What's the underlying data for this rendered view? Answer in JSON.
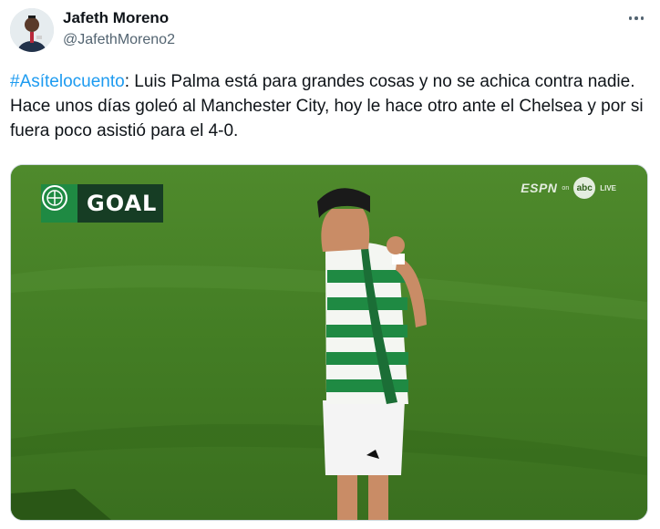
{
  "author": {
    "name": "Jafeth Moreno",
    "handle": "@JafethMoreno2"
  },
  "icons": {
    "avatar": "avatar-photo",
    "more": "more-options-icon",
    "club_crest": "celtic-crest-icon"
  },
  "tweet": {
    "hashtag": "#Asítelocuento",
    "body": ": Luis Palma está para grandes cosas y no se achica contra nadie. Hace unos días goleó al Manchester City, hoy le hace otro ante el Chelsea y por si fuera poco asistió para el 4-0."
  },
  "media": {
    "overlay_label": "GOAL",
    "broadcaster": "ESPN",
    "broadcaster_on": "on",
    "network": "abc",
    "live": "LIVE"
  },
  "colors": {
    "hashtag": "#1d9bf0",
    "text": "#0f1419",
    "secondary": "#536471",
    "pitch": "#3f7a22",
    "goal_badge": "#163d24",
    "celtic_green": "#1f8a43"
  }
}
